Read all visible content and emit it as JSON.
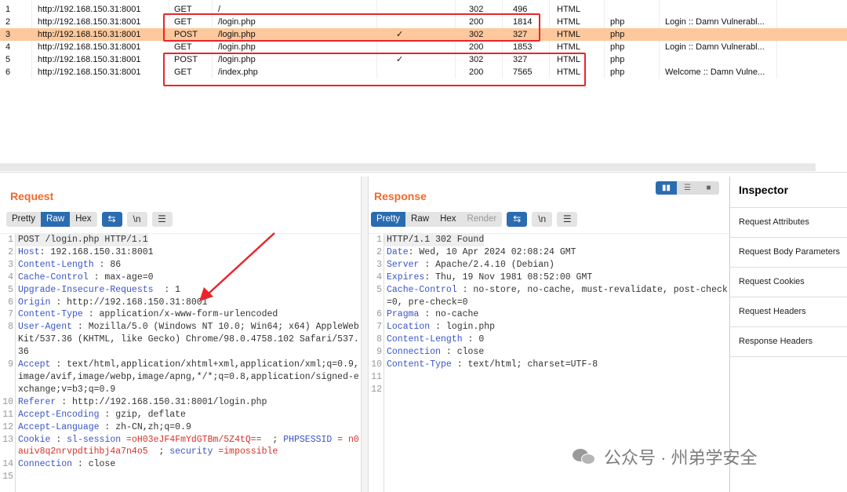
{
  "history": {
    "rows": [
      {
        "n": "1",
        "host": "http://192.168.150.31:8001",
        "method": "GET",
        "url": "/",
        "check": "",
        "status": "302",
        "length": "496",
        "mime": "HTML",
        "ext": "",
        "title": ""
      },
      {
        "n": "2",
        "host": "http://192.168.150.31:8001",
        "method": "GET",
        "url": "/login.php",
        "check": "",
        "status": "200",
        "length": "1814",
        "mime": "HTML",
        "ext": "php",
        "title": "Login :: Damn Vulnerabl..."
      },
      {
        "n": "3",
        "host": "http://192.168.150.31:8001",
        "method": "POST",
        "url": "/login.php",
        "check": "✓",
        "status": "302",
        "length": "327",
        "mime": "HTML",
        "ext": "php",
        "title": ""
      },
      {
        "n": "4",
        "host": "http://192.168.150.31:8001",
        "method": "GET",
        "url": "/login.php",
        "check": "",
        "status": "200",
        "length": "1853",
        "mime": "HTML",
        "ext": "php",
        "title": "Login :: Damn Vulnerabl..."
      },
      {
        "n": "5",
        "host": "http://192.168.150.31:8001",
        "method": "POST",
        "url": "/login.php",
        "check": "✓",
        "status": "302",
        "length": "327",
        "mime": "HTML",
        "ext": "php",
        "title": ""
      },
      {
        "n": "6",
        "host": "http://192.168.150.31:8001",
        "method": "GET",
        "url": "/index.php",
        "check": "",
        "status": "200",
        "length": "7565",
        "mime": "HTML",
        "ext": "php",
        "title": "Welcome :: Damn Vulne..."
      }
    ],
    "selected_row": "3"
  },
  "request": {
    "title": "Request",
    "tabs": [
      "Pretty",
      "Raw",
      "Hex"
    ],
    "active_tab": "Raw",
    "buttons": {
      "wrap": "⇆",
      "newline": "\\n",
      "menu": "☰"
    },
    "lines": [
      {
        "n": "1",
        "text": "POST /login.php HTTP/1.1"
      },
      {
        "n": "2",
        "k": "Host",
        "v": ": 192.168.150.31:8001"
      },
      {
        "n": "3",
        "k": "Content-Length",
        "v": " : 86"
      },
      {
        "n": "4",
        "k": "Cache-Control",
        "v": " : max-age=0"
      },
      {
        "n": "5",
        "k": "Upgrade-Insecure-Requests",
        "v": "  : 1"
      },
      {
        "n": "6",
        "k": "Origin",
        "v": " : http://192.168.150.31:8001"
      },
      {
        "n": "7",
        "k": "Content-Type",
        "v": " : application/x-www-form-urlencoded"
      },
      {
        "n": "8",
        "k": "User-Agent",
        "v": " : Mozilla/5.0 (Windows NT 10.0; Win64; x64) AppleWebKit/537.36 (KHTML, like Gecko) Chrome/98.0.4758.102 Safari/537.36"
      },
      {
        "n": "9",
        "k": "Accept",
        "v": " : text/html,application/xhtml+xml,application/xml;q=0.9,image/avif,image/webp,image/apng,*/*;q=0.8,application/signed-exchange;v=b3;q=0.9"
      },
      {
        "n": "10",
        "k": "Referer",
        "v": " : http://192.168.150.31:8001/login.php"
      },
      {
        "n": "11",
        "k": "Accept-Encoding",
        "v": " : gzip, deflate"
      },
      {
        "n": "12",
        "k": "Accept-Language",
        "v": " : zh-CN,zh;q=0.9"
      },
      {
        "n": "13",
        "k": "Cookie",
        "v": " : ",
        "c1k": "sl-session",
        "c1v": " =oH03eJF4FmYdGTBm/5Z4tQ==",
        "sep1": "  ; ",
        "c2k": "PHPSESSID",
        "c2v": " = n0auiv8q2nrvpdtihbj4a7n4o5",
        "sep2": "  ; ",
        "c3k": "security",
        "c3v": " =impossible"
      },
      {
        "n": "14",
        "k": "Connection",
        "v": " : close"
      },
      {
        "n": "15",
        "text": ""
      }
    ]
  },
  "response": {
    "title": "Response",
    "tabs": [
      "Pretty",
      "Raw",
      "Hex",
      "Render"
    ],
    "active_tab": "Pretty",
    "lines": [
      {
        "n": "1",
        "text": "HTTP/1.1 302 Found"
      },
      {
        "n": "2",
        "k": "Date",
        "v": ": Wed, 10 Apr 2024 02:08:24 GMT"
      },
      {
        "n": "3",
        "k": "Server",
        "v": " : Apache/2.4.10 (Debian)"
      },
      {
        "n": "4",
        "k": "Expires",
        "v": ": Thu, 19 Nov 1981 08:52:00 GMT"
      },
      {
        "n": "5",
        "k": "Cache-Control",
        "v": " : no-store, no-cache, must-revalidate, post-check=0, pre-check=0"
      },
      {
        "n": "6",
        "k": "Pragma",
        "v": " : no-cache"
      },
      {
        "n": "7",
        "k": "Location",
        "v": " : login.php"
      },
      {
        "n": "8",
        "k": "Content-Length",
        "v": " : 0"
      },
      {
        "n": "9",
        "k": "Connection",
        "v": " : close"
      },
      {
        "n": "10",
        "k": "Content-Type",
        "v": " : text/html; charset=UTF-8"
      },
      {
        "n": "11",
        "text": ""
      },
      {
        "n": "12",
        "text": ""
      }
    ]
  },
  "inspector": {
    "title": "Inspector",
    "items": [
      "Request Attributes",
      "Request Body Parameters",
      "Request Cookies",
      "Request Headers",
      "Response Headers"
    ]
  },
  "watermark": "公众号 · 州弟学安全",
  "colors": {
    "accent": "#f06a2a",
    "selected_row": "#fcc89c",
    "annotation": "#e8262a",
    "active_tab": "#2b6cb0"
  }
}
